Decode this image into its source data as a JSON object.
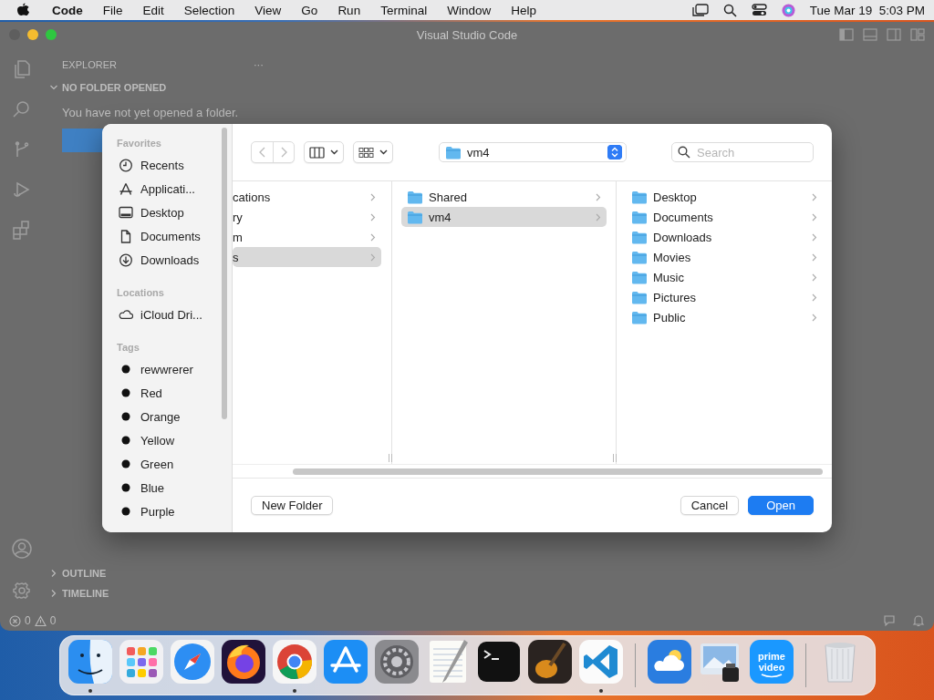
{
  "menu_bar": {
    "items": [
      "Code",
      "File",
      "Edit",
      "Selection",
      "View",
      "Go",
      "Run",
      "Terminal",
      "Window",
      "Help"
    ],
    "clock": "Tue Mar 19  5:03 PM"
  },
  "editor_window": {
    "title": "Visual Studio Code",
    "explorer": {
      "title": "EXPLORER",
      "more": "···",
      "section": "NO FOLDER OPENED",
      "message": "You have not yet opened a folder."
    },
    "panels": [
      {
        "label": "OUTLINE",
        "expanded": false
      },
      {
        "label": "TIMELINE",
        "expanded": false
      }
    ],
    "status_bar": {
      "errors": "0",
      "warnings": "0"
    }
  },
  "open_dialog": {
    "sidebar": [
      {
        "heading": "Favorites",
        "items": [
          {
            "label": "Recents",
            "kind": "clock"
          },
          {
            "label": "Applicati...",
            "kind": "apps"
          },
          {
            "label": "Desktop",
            "kind": "desktop"
          },
          {
            "label": "Documents",
            "kind": "doc"
          },
          {
            "label": "Downloads",
            "kind": "download"
          }
        ]
      },
      {
        "heading": "Locations",
        "items": [
          {
            "label": "iCloud Dri...",
            "kind": "cloud"
          }
        ]
      },
      {
        "heading": "Tags",
        "items": [
          {
            "label": "rewwrerer",
            "kind": "tag"
          },
          {
            "label": "Red",
            "kind": "tag"
          },
          {
            "label": "Orange",
            "kind": "tag"
          },
          {
            "label": "Yellow",
            "kind": "tag"
          },
          {
            "label": "Green",
            "kind": "tag"
          },
          {
            "label": "Blue",
            "kind": "tag"
          },
          {
            "label": "Purple",
            "kind": "tag"
          }
        ]
      }
    ],
    "location": "vm4",
    "search": {
      "placeholder": "Search"
    },
    "columns": [
      [
        {
          "name": "cations",
          "selected": false,
          "folder": false
        },
        {
          "name": "ry",
          "selected": false,
          "folder": false
        },
        {
          "name": "m",
          "selected": false,
          "folder": false
        },
        {
          "name": "s",
          "selected": true,
          "folder": false
        }
      ],
      [
        {
          "name": "Shared",
          "selected": false,
          "folder": true
        },
        {
          "name": "vm4",
          "selected": true,
          "folder": true
        }
      ],
      [
        {
          "name": "Desktop",
          "selected": false,
          "folder": true
        },
        {
          "name": "Documents",
          "selected": false,
          "folder": true
        },
        {
          "name": "Downloads",
          "selected": false,
          "folder": true
        },
        {
          "name": "Movies",
          "selected": false,
          "folder": true
        },
        {
          "name": "Music",
          "selected": false,
          "folder": true
        },
        {
          "name": "Pictures",
          "selected": false,
          "folder": true
        },
        {
          "name": "Public",
          "selected": false,
          "folder": true
        }
      ]
    ],
    "buttons": [
      {
        "label": "New Folder",
        "kind": "secondary"
      },
      {
        "label": "Cancel",
        "kind": "secondary"
      },
      {
        "label": "Open",
        "kind": "primary"
      }
    ]
  },
  "dock": {
    "groups": [
      [
        {
          "kind": "finder",
          "running": true
        },
        {
          "kind": "launchpad",
          "running": false
        },
        {
          "kind": "safari",
          "running": false
        },
        {
          "kind": "firefox",
          "running": false
        },
        {
          "kind": "chrome",
          "running": true
        },
        {
          "kind": "appstore",
          "running": false
        },
        {
          "kind": "settings",
          "running": false
        },
        {
          "kind": "textedit",
          "running": false
        },
        {
          "kind": "terminal",
          "running": false
        },
        {
          "kind": "guitar",
          "running": false
        },
        {
          "kind": "vscode",
          "running": true
        }
      ],
      [
        {
          "kind": "weather",
          "running": false
        },
        {
          "kind": "preview",
          "running": false
        },
        {
          "kind": "video",
          "running": false,
          "label": "prime video"
        }
      ],
      [
        {
          "kind": "trash",
          "running": false
        }
      ]
    ]
  }
}
